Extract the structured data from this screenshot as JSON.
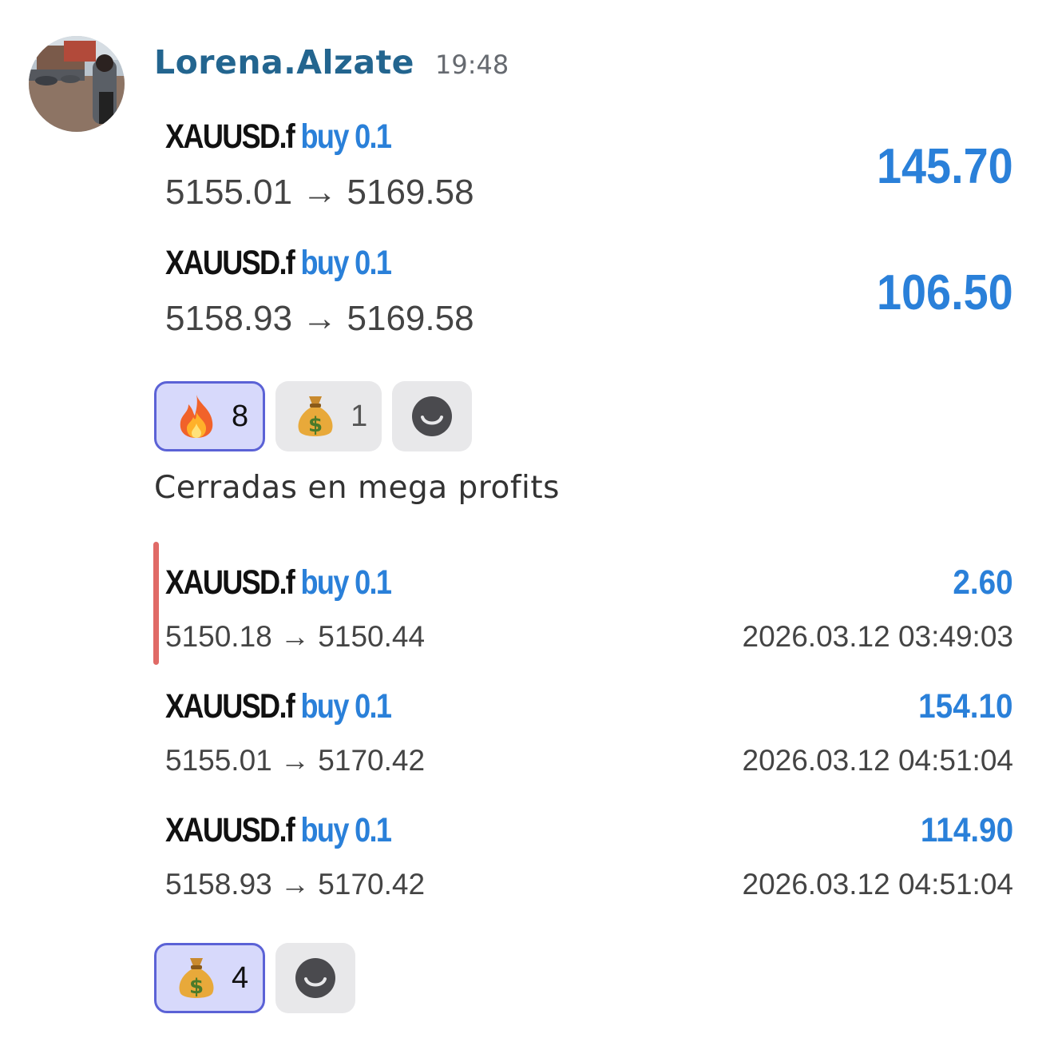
{
  "message": {
    "author": "Lorena.Alzate",
    "time": "19:48",
    "trades_open": [
      {
        "symbol": "XAUUSD.f",
        "side": "buy 0.1",
        "prices": "5155.01 → 5169.58",
        "profit": "145.70"
      },
      {
        "symbol": "XAUUSD.f",
        "side": "buy 0.1",
        "prices": "5158.93 → 5169.58",
        "profit": "106.50"
      }
    ],
    "reactions_1": [
      {
        "emoji": "fire-emoji",
        "count": "8",
        "active": true
      },
      {
        "emoji": "money-bag-emoji",
        "count": "1",
        "active": false
      }
    ],
    "caption": "Cerradas en mega profits",
    "trades_closed": [
      {
        "symbol": "XAUUSD.f",
        "side": "buy 0.1",
        "prices": "5150.18 → 5150.44",
        "profit": "2.60",
        "timestamp": "2026.03.12 03:49:03"
      },
      {
        "symbol": "XAUUSD.f",
        "side": "buy 0.1",
        "prices": "5155.01 → 5170.42",
        "profit": "154.10",
        "timestamp": "2026.03.12 04:51:04"
      },
      {
        "symbol": "XAUUSD.f",
        "side": "buy 0.1",
        "prices": "5158.93 → 5170.42",
        "profit": "114.90",
        "timestamp": "2026.03.12 04:51:04"
      }
    ],
    "reactions_2": [
      {
        "emoji": "money-bag-emoji",
        "count": "4",
        "active": true
      }
    ]
  },
  "colors": {
    "author": "#23658f",
    "accent_blue": "#2a80d9",
    "reaction_active_bg": "#d7d9fb",
    "reaction_active_border": "#5b62d6",
    "quote_bar": "#e06a66"
  }
}
